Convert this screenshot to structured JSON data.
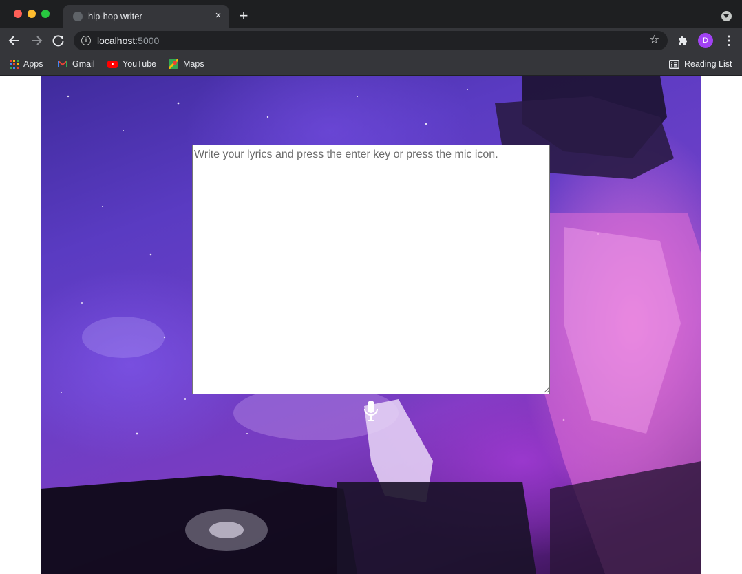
{
  "browser": {
    "tab_title": "hip-hop writer",
    "close_glyph": "×",
    "new_tab_glyph": "+",
    "url_host": "localhost",
    "url_port": ":5000",
    "profile_initial": "D",
    "bookmarks": {
      "apps": "Apps",
      "gmail": "Gmail",
      "youtube": "YouTube",
      "maps": "Maps",
      "reading_list": "Reading List"
    },
    "icons": [
      "back-arrow-icon",
      "forward-arrow-icon",
      "reload-icon",
      "info-icon",
      "star-icon",
      "extensions-icon",
      "more-menu-icon"
    ]
  },
  "page": {
    "lyrics_placeholder": "Write your lyrics and press the enter key or press the mic icon.",
    "lyrics_value": "",
    "mic_icon": "microphone-icon"
  },
  "colors": {
    "accent_profile": "#a142f4",
    "youtube_red": "#ff0000"
  }
}
